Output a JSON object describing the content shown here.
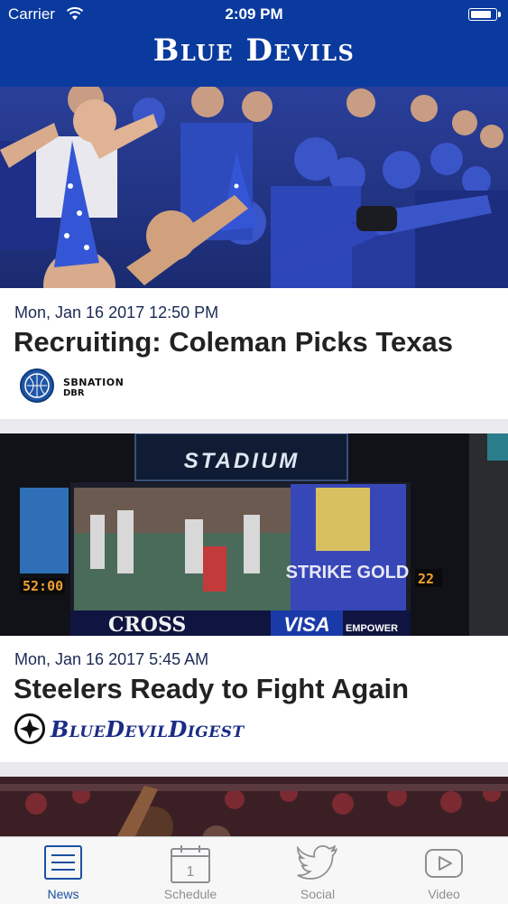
{
  "status_bar": {
    "carrier": "Carrier",
    "time": "2:09 PM"
  },
  "nav": {
    "title": "Blue Devils"
  },
  "feed": [
    {
      "date": "Mon, Jan 16 2017 12:50 PM",
      "headline": "Recruiting: Coleman Picks Texas",
      "source_name": "SBNATION",
      "source_sub": "DBR",
      "image_description": "crowd-photo"
    },
    {
      "date": "Mon, Jan 16 2017 5:45 AM",
      "headline": "Steelers Ready to Fight Again",
      "source_name": "BlueDevilDigest",
      "image_description": "stadium-scoreboard-photo",
      "scoreboard": {
        "stadium_text": "STADIUM",
        "clock_left": "52:00",
        "clock_right": "22",
        "ad_strike_gold": "STRIKE GOLD",
        "ad_cross": "CROSS",
        "ad_visa": "VISA",
        "ad_empower": "EMPOWER"
      }
    },
    {
      "image_description": "basketball-photo"
    }
  ],
  "tab_bar": {
    "active": "News",
    "items": [
      {
        "label": "News",
        "icon": "list-icon"
      },
      {
        "label": "Schedule",
        "icon": "calendar-icon"
      },
      {
        "label": "Social",
        "icon": "twitter-icon"
      },
      {
        "label": "Video",
        "icon": "play-icon"
      }
    ],
    "calendar_day": "1"
  },
  "colors": {
    "nav_blue": "#0a3a9e",
    "active_tab": "#1c4fa0",
    "inactive_tab": "#8e8e93",
    "source_blue": "#1a2c86"
  }
}
